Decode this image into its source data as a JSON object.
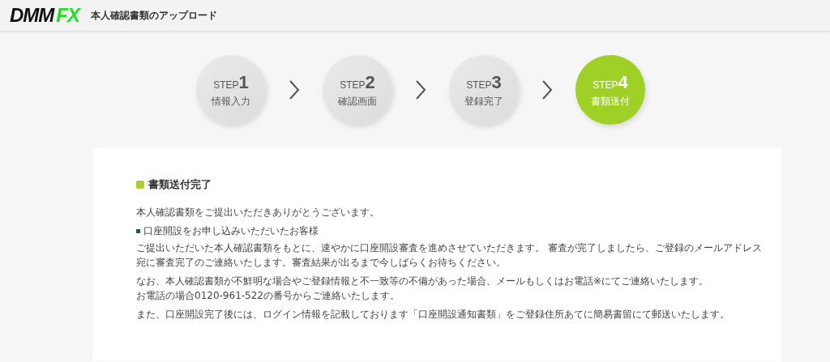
{
  "header": {
    "logo": {
      "main": "DMM",
      "accent": "FX"
    },
    "title": "本人確認書類のアップロード"
  },
  "steps": [
    {
      "label": "STEP",
      "number": "1",
      "name": "情報入力",
      "selected": false
    },
    {
      "label": "STEP",
      "number": "2",
      "name": "確認画面",
      "selected": false
    },
    {
      "label": "STEP",
      "number": "3",
      "name": "登録完了",
      "selected": false
    },
    {
      "label": "STEP",
      "number": "4",
      "name": "書類送付",
      "selected": true
    }
  ],
  "content": {
    "heading": "書類送付完了",
    "blocks": [
      {
        "kind": "paragraph",
        "lines": [
          "本人確認書類をご提出いただきありがとうございます。"
        ]
      },
      {
        "kind": "subheading",
        "lines": [
          "口座開設をお申し込みいただいたお客様"
        ]
      },
      {
        "kind": "paragraph",
        "lines": [
          "ご提出いただいた本人確認書類をもとに、速やかに口座開設審査を進めさせていただきます。 審査が完了しましたら、ご登録のメールアドレス",
          "宛に審査完了のご連絡いたします。審査結果が出るまで今しばらくお待ちください。"
        ]
      },
      {
        "kind": "paragraph",
        "lines": [
          "なお、本人確認書類が不鮮明な場合やご登録情報と不一致等の不備があった場合、メールもしくはお電話※にてご連絡いたします。",
          "お電話の場合0120-961-522の番号からご連絡いたします。"
        ]
      },
      {
        "kind": "paragraph",
        "lines": [
          "また、口座開設完了後には、ログイン情報を記載しております「口座開設通知書類」をご登録住所あてに簡易書留にて郵送いたします。"
        ]
      }
    ]
  }
}
